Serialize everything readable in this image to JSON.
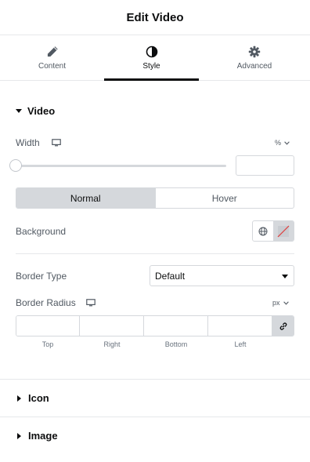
{
  "header": {
    "title": "Edit Video"
  },
  "tabs": [
    {
      "label": "Content",
      "icon": "pencil-icon",
      "active": false
    },
    {
      "label": "Style",
      "icon": "contrast-icon",
      "active": true
    },
    {
      "label": "Advanced",
      "icon": "gear-icon",
      "active": false
    }
  ],
  "sections": {
    "video": {
      "title": "Video",
      "expanded": true,
      "width": {
        "label": "Width",
        "unit": "%",
        "value": "",
        "slider_value": 0
      },
      "state_toggle": {
        "options": [
          "Normal",
          "Hover"
        ],
        "selected": "Normal"
      },
      "background": {
        "label": "Background"
      },
      "border_type": {
        "label": "Border Type",
        "value": "Default"
      },
      "border_radius": {
        "label": "Border Radius",
        "unit": "px",
        "fields": [
          "Top",
          "Right",
          "Bottom",
          "Left"
        ]
      }
    },
    "icon": {
      "title": "Icon",
      "expanded": false
    },
    "image": {
      "title": "Image",
      "expanded": false
    }
  },
  "colors": {
    "accent": "#0c0d0e",
    "border": "#d5d8dc",
    "active_toggle": "#d5d8dc",
    "text": "#515962"
  }
}
